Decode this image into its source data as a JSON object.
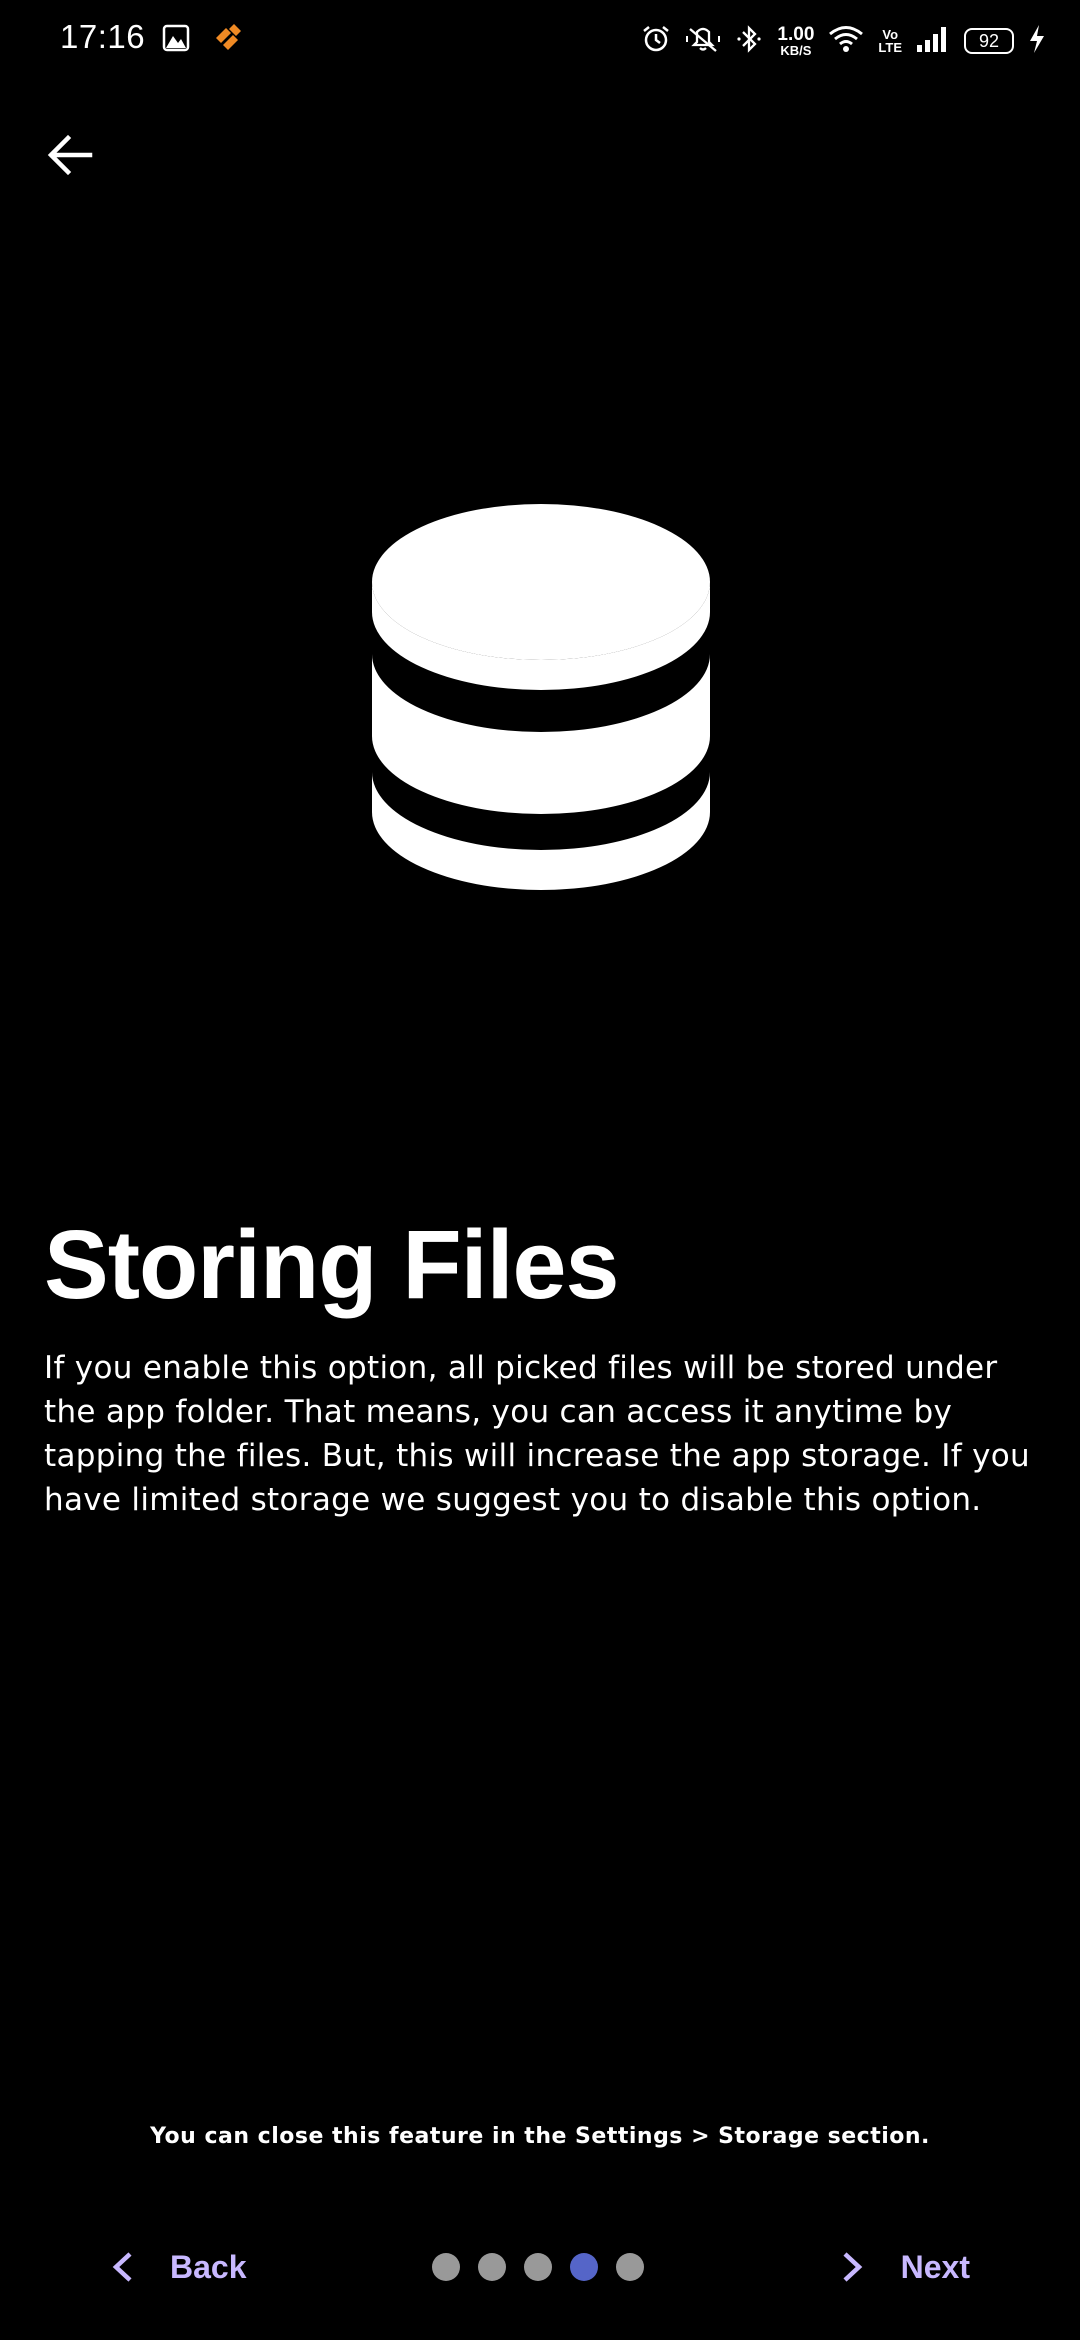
{
  "status_bar": {
    "time": "17:16",
    "net_speed_value": "1.00",
    "net_speed_unit": "KB/S",
    "volte_top": "Vo",
    "volte_bottom": "LTE",
    "battery_level": "92",
    "icons": [
      "gallery-icon",
      "app-notification-icon",
      "alarm-icon",
      "vibrate-icon",
      "bluetooth-icon",
      "wifi-icon",
      "signal-icon",
      "battery-icon",
      "charging-icon"
    ]
  },
  "header": {
    "back_icon": "arrow-left-icon"
  },
  "hero": {
    "icon": "database-icon"
  },
  "content": {
    "title": "Storing Files",
    "description": "If you enable this option, all picked files will be stored under the app folder. That means, you can access it anytime by tapping the files. But, this will increase the app storage. If you have limited storage we suggest you to disable this option."
  },
  "footer": {
    "note": "You can close this feature in the Settings > Storage section.",
    "back_label": "Back",
    "next_label": "Next",
    "pages_total": 5,
    "current_page": 4
  },
  "colors": {
    "background": "#000000",
    "nav_text": "#c8b8ff",
    "dot_inactive": "#999999",
    "dot_active": "#5565c8"
  }
}
